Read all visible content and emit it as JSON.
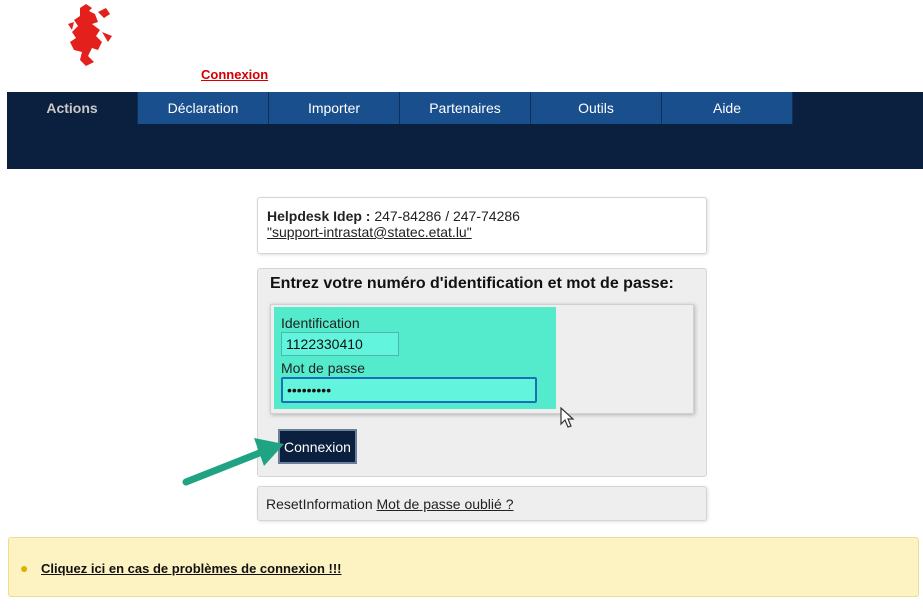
{
  "header": {
    "login_link": "Connexion"
  },
  "nav": {
    "items": [
      {
        "label": "Actions",
        "active": true
      },
      {
        "label": "Déclaration"
      },
      {
        "label": "Importer"
      },
      {
        "label": "Partenaires"
      },
      {
        "label": "Outils"
      },
      {
        "label": "Aide"
      }
    ]
  },
  "helpdesk": {
    "label": "Helpdesk Idep :",
    "phones": " 247-84286 / 247-74286",
    "email": "\"support-intrastat@statec.etat.lu\""
  },
  "login": {
    "title": "Entrez votre numéro d'identification et mot de passe:",
    "id_label": "Identification",
    "id_value": "1122330410",
    "pw_label": "Mot de passe",
    "pw_value": "•••••••••",
    "submit_label": "Connexion"
  },
  "reset": {
    "text": "ResetInformation ",
    "link": "Mot de passe oublié ?"
  },
  "warning": {
    "link": "Cliquez ici en cas de problèmes de connexion !!!"
  },
  "colors": {
    "nav_dark": "#0b1f3f",
    "nav_blue": "#1a4f8e",
    "highlight": "#53ebcc",
    "accent_red": "#d40000",
    "arrow": "#1fa383"
  },
  "icons": [
    "luxembourg-lion-logo",
    "lightbulb-icon",
    "annotation-arrow",
    "mouse-cursor-icon"
  ]
}
